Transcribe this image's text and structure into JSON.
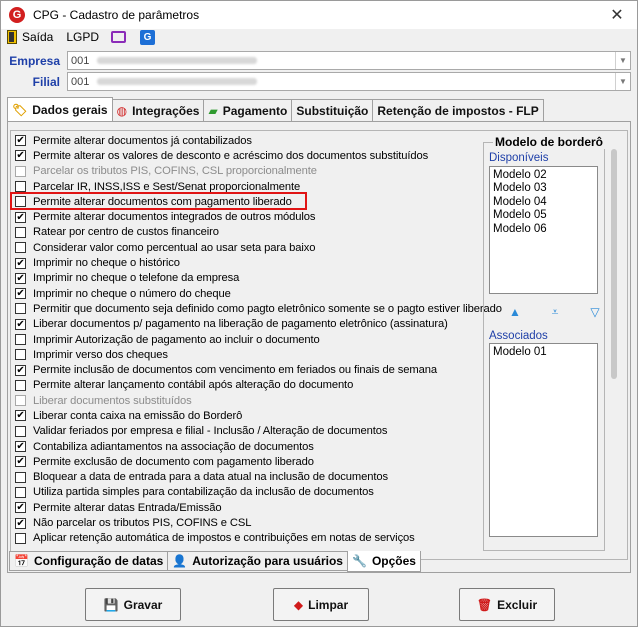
{
  "window": {
    "title": "CPG - Cadastro de parâmetros",
    "close": "✕",
    "app_icon": "G"
  },
  "toolbar": {
    "exit_label": "Saída",
    "lgpd_label": "LGPD",
    "g_icon": "G"
  },
  "fields": {
    "empresa_label": "Empresa",
    "empresa_value": "001",
    "filial_label": "Filial",
    "filial_value": "001"
  },
  "tabs": [
    {
      "label": "Dados gerais",
      "icon": "tag-icon"
    },
    {
      "label": "Integrações",
      "icon": "integration-icon"
    },
    {
      "label": "Pagamento",
      "icon": "money-icon"
    },
    {
      "label": "Substituição"
    },
    {
      "label": "Retenção de impostos - FLP"
    }
  ],
  "options": [
    {
      "label": "Permite alterar documentos já contabilizados",
      "checked": true,
      "disabled": false
    },
    {
      "label": "Permite alterar os valores de desconto e acréscimo dos documentos substituídos",
      "checked": true,
      "disabled": false
    },
    {
      "label": "Parcelar os tributos PIS, COFINS, CSL proporcionalmente",
      "checked": false,
      "disabled": true
    },
    {
      "label": "Parcelar IR, INSS,ISS e Sest/Senat proporcionalmente",
      "checked": false,
      "disabled": false
    },
    {
      "label": "Permite alterar documentos com pagamento liberado",
      "checked": false,
      "disabled": false
    },
    {
      "label": "Permite alterar documentos integrados de outros módulos",
      "checked": true,
      "disabled": false
    },
    {
      "label": "Ratear por centro de custos financeiro",
      "checked": false,
      "disabled": false
    },
    {
      "label": "Considerar valor como percentual ao usar seta para baixo",
      "checked": false,
      "disabled": false
    },
    {
      "label": "Imprimir no cheque o histórico",
      "checked": true,
      "disabled": false
    },
    {
      "label": "Imprimir no cheque o telefone da empresa",
      "checked": true,
      "disabled": false
    },
    {
      "label": "Imprimir no cheque o número do cheque",
      "checked": true,
      "disabled": false
    },
    {
      "label": "Permitir que documento seja definido como pagto eletrônico somente se o pagto estiver liberado",
      "checked": false,
      "disabled": false
    },
    {
      "label": "Liberar documentos p/ pagamento na liberação de pagamento eletrônico (assinatura)",
      "checked": true,
      "disabled": false
    },
    {
      "label": "Imprimir Autorização de pagamento ao incluir o documento",
      "checked": false,
      "disabled": false
    },
    {
      "label": "Imprimir verso dos cheques",
      "checked": false,
      "disabled": false
    },
    {
      "label": "Permite inclusão de documentos com vencimento em feriados ou finais de semana",
      "checked": true,
      "disabled": false
    },
    {
      "label": "Permite alterar lançamento contábil após alteração do documento",
      "checked": false,
      "disabled": false
    },
    {
      "label": "Liberar documentos substituídos",
      "checked": false,
      "disabled": true
    },
    {
      "label": "Liberar conta caixa na emissão do Borderô",
      "checked": true,
      "disabled": false
    },
    {
      "label": "Validar feriados por empresa e filial - Inclusão / Alteração de documentos",
      "checked": false,
      "disabled": false
    },
    {
      "label": "Contabiliza adiantamentos na associação de documentos",
      "checked": true,
      "disabled": false
    },
    {
      "label": "Permite exclusão de documento com pagamento liberado",
      "checked": true,
      "disabled": false
    },
    {
      "label": "Bloquear a data de entrada para a data atual na inclusão de documentos",
      "checked": false,
      "disabled": false
    },
    {
      "label": "Utiliza partida simples para contabilização da inclusão de documentos",
      "checked": false,
      "disabled": false
    },
    {
      "label": "Permite alterar datas Entrada/Emissão",
      "checked": true,
      "disabled": false
    },
    {
      "label": "Não parcelar os tributos PIS, COFINS e CSL",
      "checked": true,
      "disabled": false
    },
    {
      "label": "Aplicar retenção automática de impostos e contribuições em notas de serviços",
      "checked": false,
      "disabled": false
    }
  ],
  "bordero": {
    "title": "Modelo de borderô",
    "available_label": "Disponíveis",
    "available": [
      "Modelo 02",
      "Modelo 03",
      "Modelo 04",
      "Modelo 05",
      "Modelo 06"
    ],
    "associated_label": "Associados",
    "associated": [
      "Modelo 01"
    ]
  },
  "bottom_tabs": [
    {
      "label": "Configuração de datas",
      "icon": "calendar-icon"
    },
    {
      "label": "Autorização para usuários",
      "icon": "user-icon"
    },
    {
      "label": "Opções",
      "icon": "tools-icon",
      "active": true
    }
  ],
  "buttons": {
    "save": "Gravar",
    "clear": "Limpar",
    "delete": "Excluir"
  }
}
